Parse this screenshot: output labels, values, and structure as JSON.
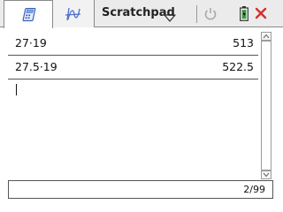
{
  "app": {
    "document_title": "Scratchpad"
  },
  "tabs": [
    {
      "name": "calculator",
      "icon": "calculator-icon",
      "active": true
    },
    {
      "name": "graphs",
      "icon": "graph-icon",
      "active": false
    }
  ],
  "toolbar": {
    "menu_icon": "chevron-down-icon",
    "undo_icon": "undo-icon",
    "battery_icon": "battery-icon",
    "close_icon": "close-icon"
  },
  "history": [
    {
      "expression": "27·19",
      "result": "513"
    },
    {
      "expression": "27.5·19",
      "result": "522.5"
    }
  ],
  "entry_line": {
    "value": ""
  },
  "status": {
    "page": "2/99"
  },
  "colors": {
    "close_accent": "#d23030",
    "tab_bar": "#ebebeb",
    "graph_icon": "#4a6fc9"
  }
}
